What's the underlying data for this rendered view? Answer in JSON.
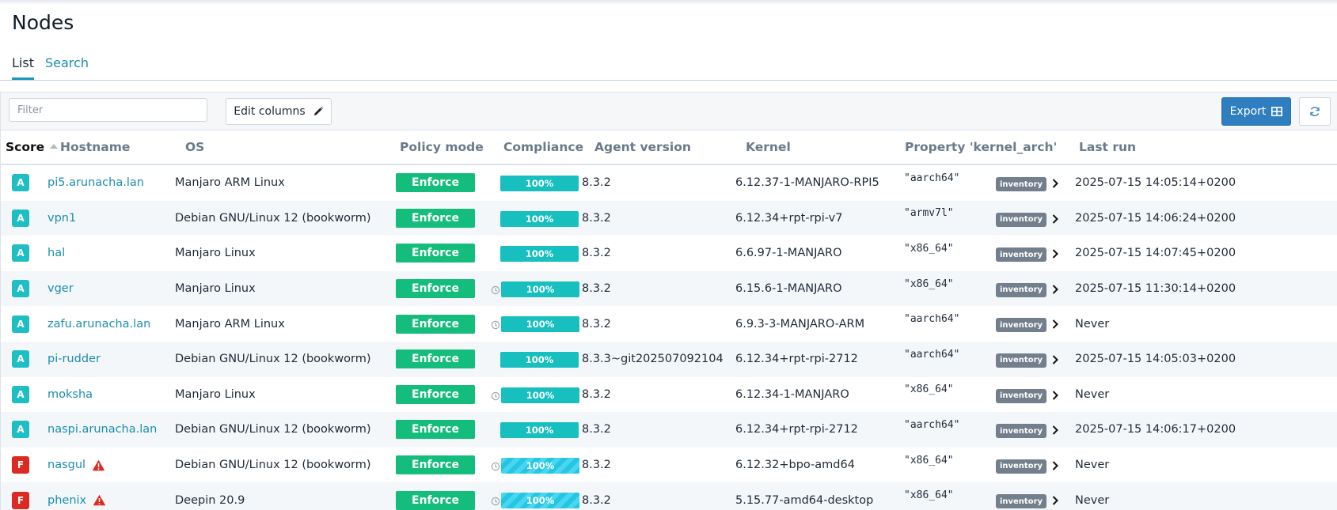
{
  "page": {
    "title": "Nodes"
  },
  "tabs": [
    {
      "label": "List",
      "active": true
    },
    {
      "label": "Search",
      "active": false
    }
  ],
  "toolbar": {
    "filter_placeholder": "Filter",
    "edit_columns_label": "Edit columns",
    "export_label": "Export"
  },
  "columns": [
    "Score",
    "Hostname",
    "OS",
    "Policy mode",
    "Compliance",
    "Agent version",
    "Kernel",
    "Property 'kernel_arch'",
    "Last run"
  ],
  "inventory_label": "inventory",
  "colors": {
    "score_a": "#1dbfc4",
    "score_f": "#dc2a22",
    "enforce": "#14bd7b",
    "compliance": "#17bfbf",
    "link": "#1b8db0",
    "export": "#2f7ec0"
  },
  "rows": [
    {
      "score": "A",
      "hostname": "pi5.arunacha.lan",
      "warning": false,
      "os": "Manjaro ARM Linux",
      "policy": "Enforce",
      "compliance": "100%",
      "compliance_value": 100,
      "clock": false,
      "striped": false,
      "agent": "8.3.2",
      "kernel": "6.12.37-1-MANJARO-RPI5",
      "arch": "\"aarch64\"",
      "last_run": "2025-07-15 14:05:14+0200"
    },
    {
      "score": "A",
      "hostname": "vpn1",
      "warning": false,
      "os": "Debian GNU/Linux 12 (bookworm)",
      "policy": "Enforce",
      "compliance": "100%",
      "compliance_value": 100,
      "clock": false,
      "striped": false,
      "agent": "8.3.2",
      "kernel": "6.12.34+rpt-rpi-v7",
      "arch": "\"armv7l\"",
      "last_run": "2025-07-15 14:06:24+0200"
    },
    {
      "score": "A",
      "hostname": "hal",
      "warning": false,
      "os": "Manjaro Linux",
      "policy": "Enforce",
      "compliance": "100%",
      "compliance_value": 100,
      "clock": false,
      "striped": false,
      "agent": "8.3.2",
      "kernel": "6.6.97-1-MANJARO",
      "arch": "\"x86_64\"",
      "last_run": "2025-07-15 14:07:45+0200"
    },
    {
      "score": "A",
      "hostname": "vger",
      "warning": false,
      "os": "Manjaro Linux",
      "policy": "Enforce",
      "compliance": "100%",
      "compliance_value": 100,
      "clock": true,
      "striped": false,
      "agent": "8.3.2",
      "kernel": "6.15.6-1-MANJARO",
      "arch": "\"x86_64\"",
      "last_run": "2025-07-15 11:30:14+0200"
    },
    {
      "score": "A",
      "hostname": "zafu.arunacha.lan",
      "warning": false,
      "os": "Manjaro ARM Linux",
      "policy": "Enforce",
      "compliance": "100%",
      "compliance_value": 100,
      "clock": true,
      "striped": false,
      "agent": "8.3.2",
      "kernel": "6.9.3-3-MANJARO-ARM",
      "arch": "\"aarch64\"",
      "last_run": "Never"
    },
    {
      "score": "A",
      "hostname": "pi-rudder",
      "warning": false,
      "os": "Debian GNU/Linux 12 (bookworm)",
      "policy": "Enforce",
      "compliance": "100%",
      "compliance_value": 100,
      "clock": false,
      "striped": false,
      "agent": "8.3.3~git202507092104",
      "kernel": "6.12.34+rpt-rpi-2712",
      "arch": "\"aarch64\"",
      "last_run": "2025-07-15 14:05:03+0200"
    },
    {
      "score": "A",
      "hostname": "moksha",
      "warning": false,
      "os": "Manjaro Linux",
      "policy": "Enforce",
      "compliance": "100%",
      "compliance_value": 100,
      "clock": true,
      "striped": false,
      "agent": "8.3.2",
      "kernel": "6.12.34-1-MANJARO",
      "arch": "\"x86_64\"",
      "last_run": "Never"
    },
    {
      "score": "A",
      "hostname": "naspi.arunacha.lan",
      "warning": false,
      "os": "Debian GNU/Linux 12 (bookworm)",
      "policy": "Enforce",
      "compliance": "100%",
      "compliance_value": 100,
      "clock": false,
      "striped": false,
      "agent": "8.3.2",
      "kernel": "6.12.34+rpt-rpi-2712",
      "arch": "\"aarch64\"",
      "last_run": "2025-07-15 14:06:17+0200"
    },
    {
      "score": "F",
      "hostname": "nasgul",
      "warning": true,
      "os": "Debian GNU/Linux 12 (bookworm)",
      "policy": "Enforce",
      "compliance": "100%",
      "compliance_value": 100,
      "clock": true,
      "striped": true,
      "agent": "8.3.2",
      "kernel": "6.12.32+bpo-amd64",
      "arch": "\"x86_64\"",
      "last_run": "Never"
    },
    {
      "score": "F",
      "hostname": "phenix",
      "warning": true,
      "os": "Deepin 20.9",
      "policy": "Enforce",
      "compliance": "100%",
      "compliance_value": 100,
      "clock": true,
      "striped": true,
      "agent": "8.3.2",
      "kernel": "5.15.77-amd64-desktop",
      "arch": "\"x86_64\"",
      "last_run": "Never"
    }
  ]
}
